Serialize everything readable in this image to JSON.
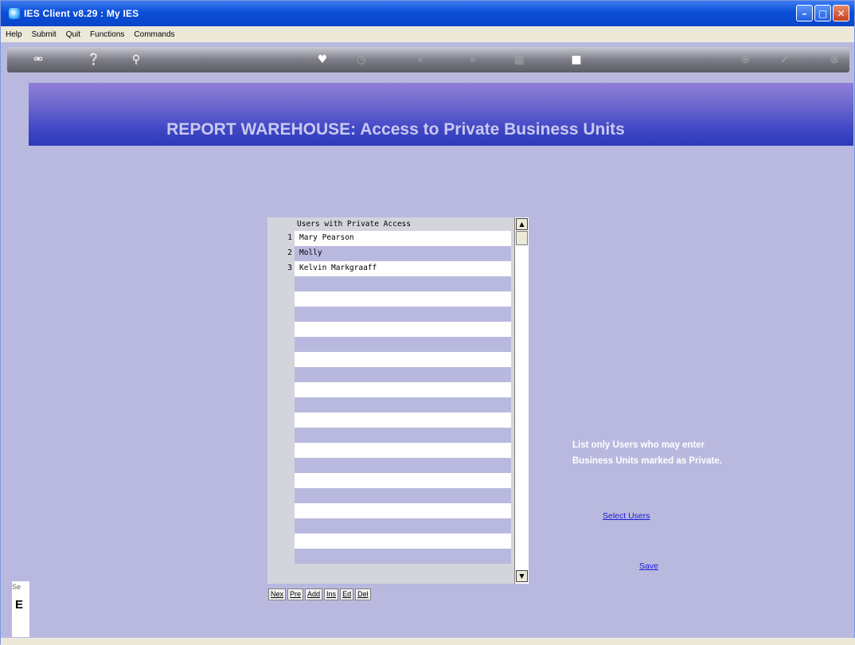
{
  "window": {
    "title": "IES Client v8.29 : My IES",
    "controls": {
      "minimize": "–",
      "maximize": "□",
      "close": "✕"
    }
  },
  "menu": [
    "Help",
    "Submit",
    "Quit",
    "Functions",
    "Commands"
  ],
  "toolbar": {
    "icons": [
      "key-icon",
      "help-icon",
      "search-icon",
      "heart-icon",
      "clock-icon",
      "rewind-icon",
      "forward-icon",
      "grid-icon",
      "stop-icon",
      "plus-icon",
      "check-icon",
      "close-icon"
    ]
  },
  "banner": {
    "title": "REPORT WAREHOUSE: Access to Private Business Units"
  },
  "list": {
    "header": "Users with Private Access",
    "rows": [
      {
        "num": "1",
        "name": "Mary Pearson"
      },
      {
        "num": "2",
        "name": "Molly"
      },
      {
        "num": "3",
        "name": "Kelvin Markgraaff"
      }
    ],
    "buttons": [
      "Nex",
      "Pre",
      "Add",
      "Ins",
      "Ed",
      "Del"
    ]
  },
  "help": {
    "line1": "List only Users who may enter",
    "line2": "Business Units marked as Private."
  },
  "links": {
    "select_users": "Select Users",
    "save": "Save"
  },
  "sidebar": {
    "fragment_label": "Se",
    "fragment_char": "E"
  }
}
